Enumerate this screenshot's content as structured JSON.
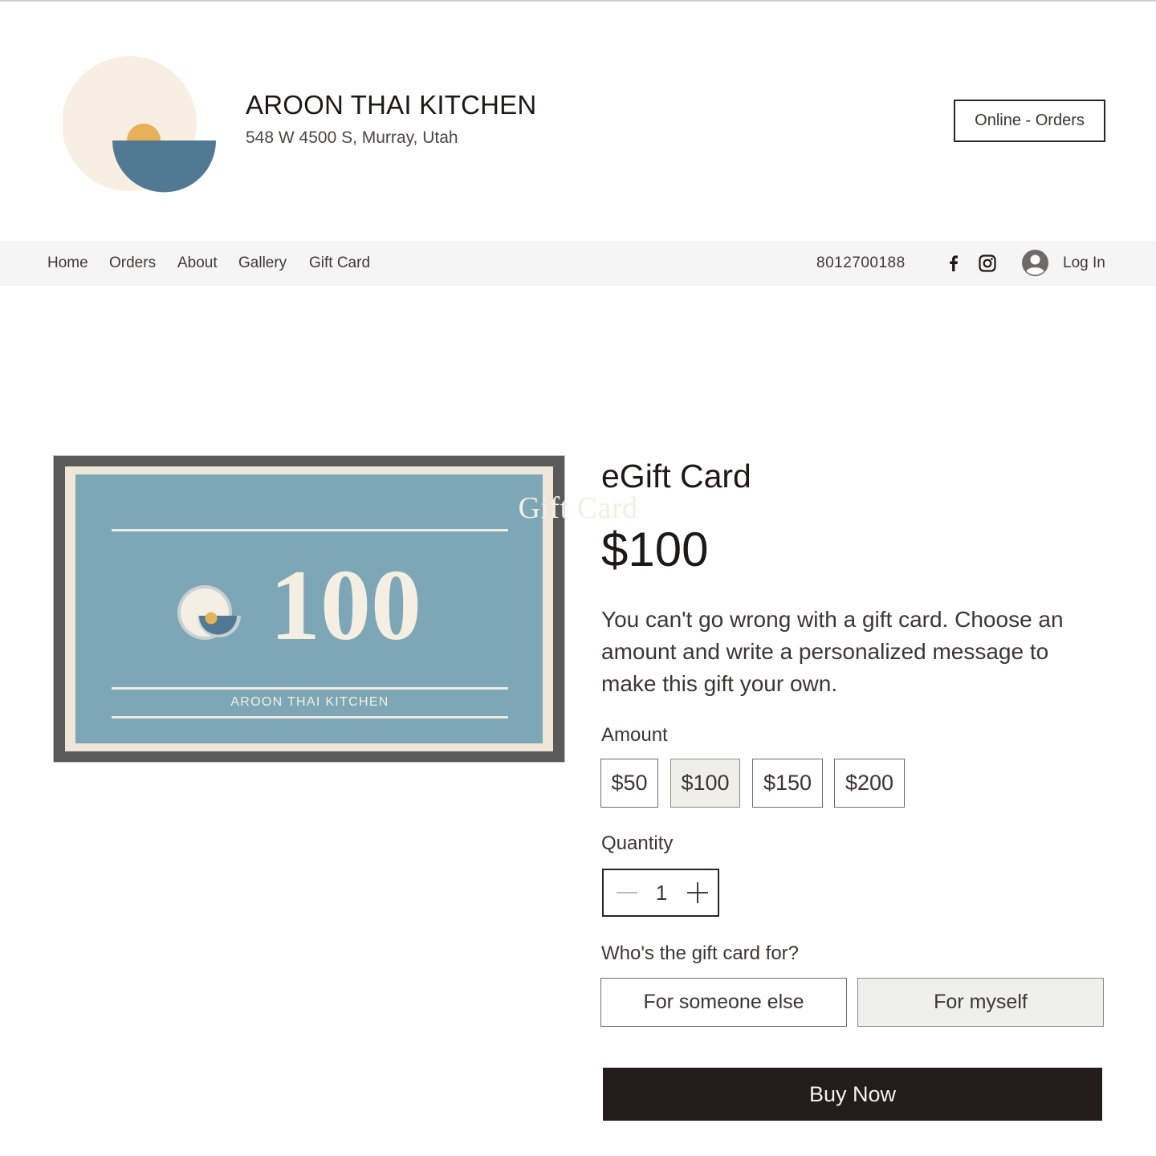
{
  "header": {
    "brand_name": "AROON THAI KITCHEN",
    "address": "548 W 4500 S, Murray, Utah",
    "cta_label": "Online - Orders"
  },
  "nav": {
    "links": [
      "Home",
      "Orders",
      "About",
      "Gallery",
      "Gift Card"
    ],
    "phone": "8012700188",
    "social_icons": [
      "facebook-icon",
      "instagram-icon"
    ],
    "login_label": "Log In"
  },
  "product_image": {
    "title": "Gift Card",
    "amount": "100",
    "brand": "AROON THAI KITCHEN"
  },
  "product": {
    "title": "eGift Card",
    "price": "$100",
    "description": "You can't go wrong with a gift card. Choose an amount and write a personalized message to make this gift your own.",
    "amount_label": "Amount",
    "amounts": [
      "$50",
      "$100",
      "$150",
      "$200"
    ],
    "selected_amount": "$100",
    "quantity_label": "Quantity",
    "quantity": "1",
    "recipient_label": "Who's the gift card for?",
    "recipient_options": [
      "For someone else",
      "For myself"
    ],
    "selected_recipient": "For myself",
    "buy_label": "Buy Now"
  },
  "colors": {
    "logo_cream": "#f8efe2",
    "logo_sun": "#e7b05a",
    "logo_blue": "#527993",
    "card_blue": "#7da7b6",
    "button_dark": "#221d1a"
  }
}
